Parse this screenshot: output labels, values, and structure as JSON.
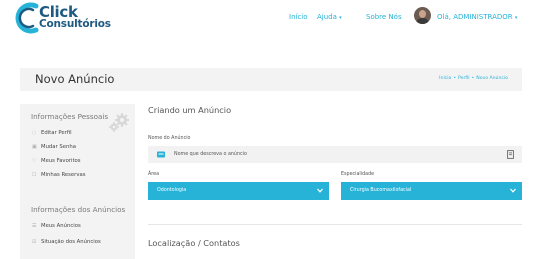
{
  "brand": {
    "line1": "Click",
    "line2": "Consultórios",
    "color": "#1f5a82"
  },
  "nav": {
    "inicio": "Início",
    "ajuda": "Ajuda",
    "sobre": "Sobre Nós",
    "user": "Olá, ADMINISTRADOR",
    "accent": "#27b3d8"
  },
  "page": {
    "title": "Novo Anúncio",
    "breadcrumb": [
      "Início",
      "Perfil",
      "Novo Anúncio"
    ]
  },
  "sidebar": {
    "section1": "Informações Pessoais",
    "items1": [
      {
        "label": "Editar Perfil",
        "icon": "user-icon"
      },
      {
        "label": "Mudar Senha",
        "icon": "lock-icon"
      },
      {
        "label": "Meus Favoritos",
        "icon": "heart-icon"
      },
      {
        "label": "Minhas Reservas",
        "icon": "calendar-icon"
      }
    ],
    "section2": "Informações dos Anúncios",
    "items2": [
      {
        "label": "Meus Anúncios",
        "icon": "list-icon"
      },
      {
        "label": "Situação dos Anúncios",
        "icon": "status-icon"
      }
    ]
  },
  "form": {
    "section_title": "Criando um Anúncio",
    "name_label": "Nome do Anúncio",
    "name_placeholder": "Nome que descreva o anúncio",
    "area_label": "Área",
    "area_value": "Odontologia",
    "especialidade_label": "Especialidade",
    "especialidade_value": "Cirurgia Bucomaxilofacial",
    "section2_title": "Localização / Contatos"
  }
}
